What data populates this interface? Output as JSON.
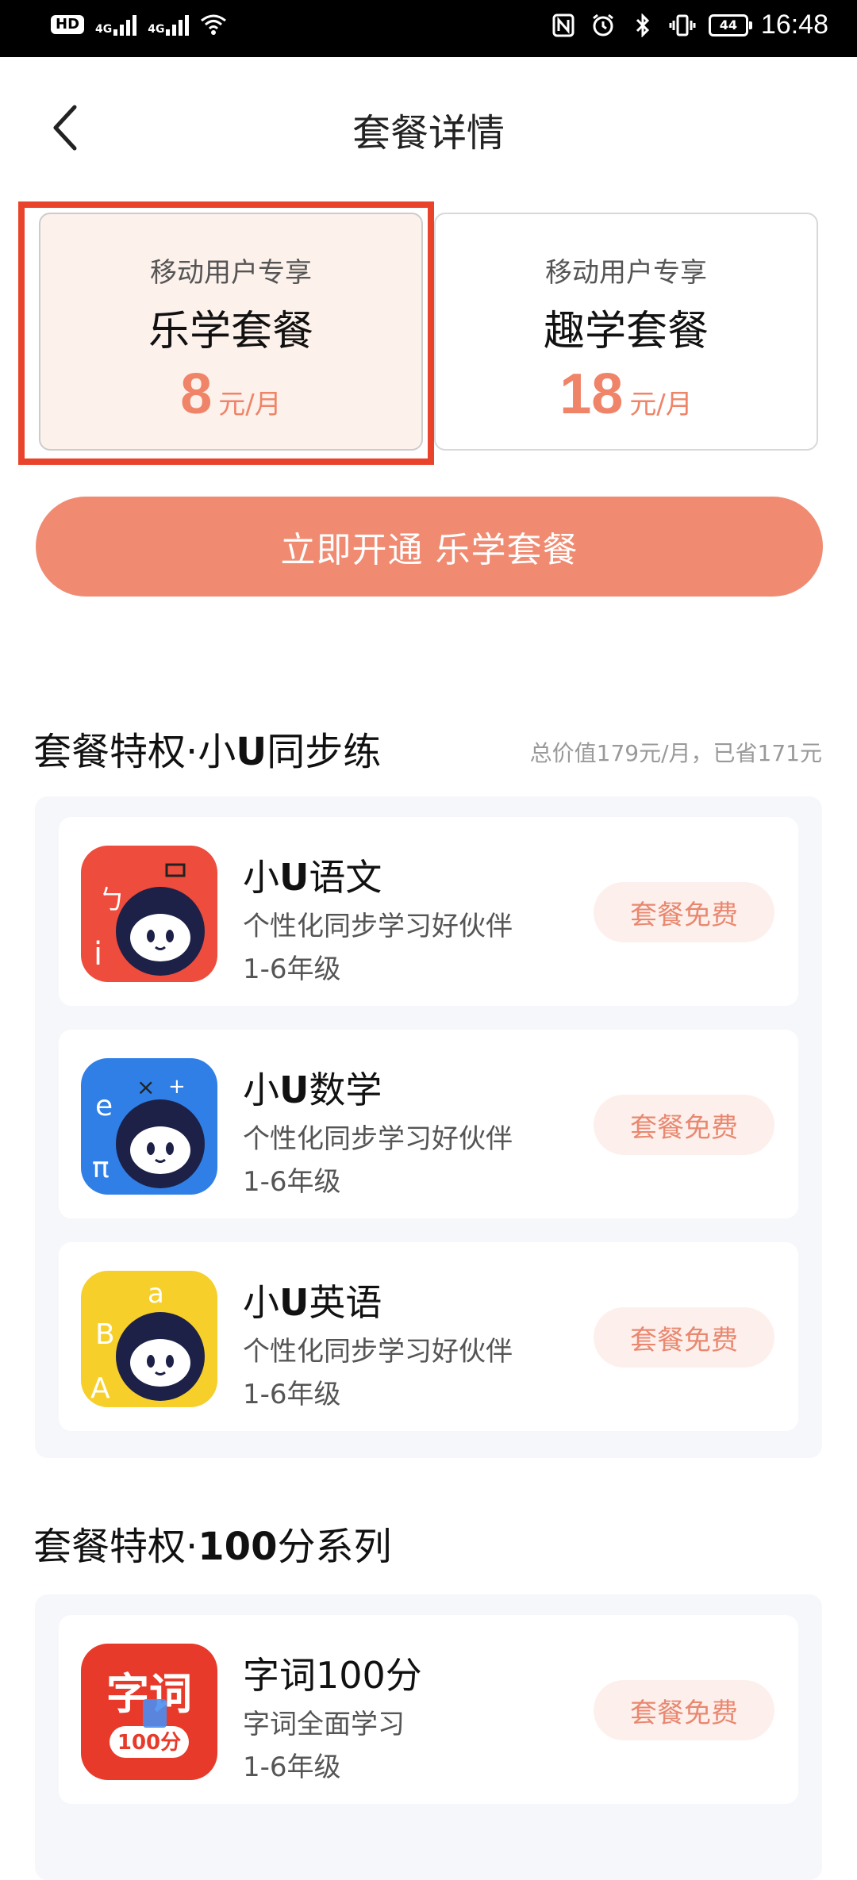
{
  "status_bar": {
    "hd_badge": "HD",
    "net1": "4G",
    "net2": "4G",
    "battery": "44",
    "time": "16:48"
  },
  "nav": {
    "title": "套餐详情"
  },
  "plans": [
    {
      "subtitle": "移动用户专享",
      "name": "乐学套餐",
      "price": "8",
      "unit": "元/月"
    },
    {
      "subtitle": "移动用户专享",
      "name": "趣学套餐",
      "price": "18",
      "unit": "元/月"
    }
  ],
  "cta_label": "立即开通 乐学套餐",
  "section1": {
    "title_prefix": "套餐特权·小",
    "title_bold": "U",
    "title_suffix": "同步练",
    "note": "总价值179元/月，已省171元",
    "items": [
      {
        "title_a": "小",
        "title_b": "U",
        "title_c": "语文",
        "desc": "个性化同步学习好伙伴",
        "grade": "1-6年级",
        "action": "套餐免费",
        "icon_color": "#ee4c3c"
      },
      {
        "title_a": "小",
        "title_b": "U",
        "title_c": "数学",
        "desc": "个性化同步学习好伙伴",
        "grade": "1-6年级",
        "action": "套餐免费",
        "icon_color": "#2f7fe6"
      },
      {
        "title_a": "小",
        "title_b": "U",
        "title_c": "英语",
        "desc": "个性化同步学习好伙伴",
        "grade": "1-6年级",
        "action": "套餐免费",
        "icon_color": "#f6cf2a"
      }
    ]
  },
  "section2": {
    "title_prefix": "套餐特权·",
    "title_bold": "100",
    "title_suffix": "分系列",
    "items": [
      {
        "title": "字词100分",
        "desc": "字词全面学习",
        "grade": "1-6年级",
        "action": "套餐免费",
        "icon_text": "字词",
        "icon_score": "100分"
      }
    ]
  },
  "colors": {
    "accent": "#f08b72",
    "highlight_border": "#e9442b",
    "price": "#ef8468",
    "status_bar": "#000000"
  }
}
